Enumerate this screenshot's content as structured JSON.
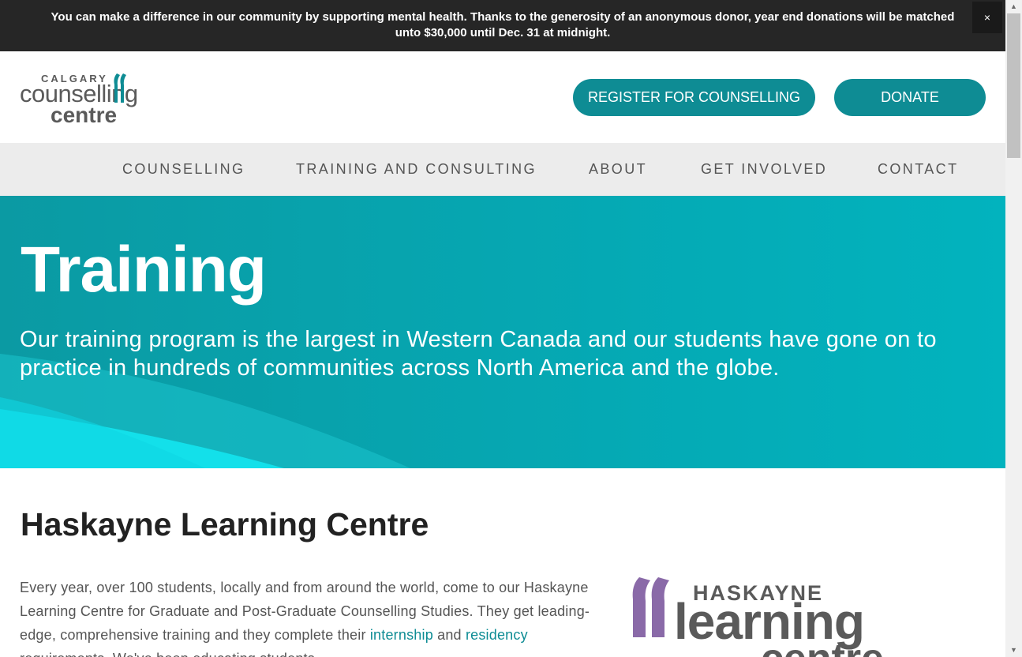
{
  "announcement": {
    "text": "You can make a difference in our community by supporting mental health. Thanks to the generosity of an anonymous donor, year end donations will be matched unto $30,000 until Dec. 31 at midnight.",
    "close_label": "×"
  },
  "logo": {
    "line1": "CALGARY",
    "line2": "counselling",
    "line3": "centre"
  },
  "header": {
    "register_label": "REGISTER FOR COUNSELLING",
    "donate_label": "DONATE"
  },
  "nav": {
    "items": [
      {
        "label": "COUNSELLING"
      },
      {
        "label": "TRAINING AND CONSULTING"
      },
      {
        "label": "ABOUT"
      },
      {
        "label": "GET INVOLVED"
      },
      {
        "label": "CONTACT"
      }
    ]
  },
  "hero": {
    "title": "Training",
    "text": "Our training program is the largest in Western Canada and our students have gone on to practice in hundreds of communities across North America and the globe."
  },
  "content": {
    "section_title": "Haskayne Learning Centre",
    "para_part1": "Every year, over 100 students, locally and from around the world, come to our Haskayne Learning Centre for Graduate and Post-Graduate Counselling Studies. They get leading-edge, comprehensive training and they complete their ",
    "link_internship": "internship",
    "para_and": " and ",
    "link_residency": "residency",
    "para_part2": " requirements. We've been educating students"
  },
  "hlc_logo": {
    "line1": "HASKAYNE",
    "line2": "learning",
    "line3": "centre"
  },
  "colors": {
    "brand_teal": "#0e8c94",
    "hero_teal": "#05a9b4",
    "logo_purple": "#8a6aa8",
    "logo_gray": "#5a5a5a"
  },
  "scrollbar": {
    "up_icon": "▲",
    "down_icon": "▼"
  }
}
